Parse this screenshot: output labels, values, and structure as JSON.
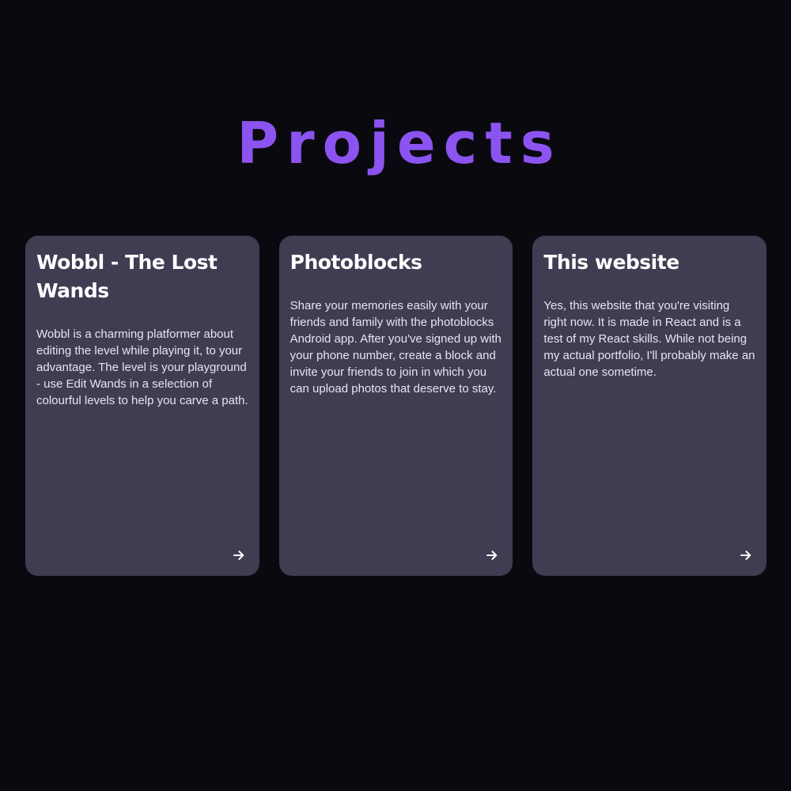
{
  "page": {
    "title": "Projects",
    "colors": {
      "background": "#0b0910",
      "accent": "#8b54f0",
      "card": "#3e3d52",
      "text": "#ffffff"
    }
  },
  "projects": [
    {
      "title": "Wobbl - The Lost Wands",
      "description": "Wobbl is a charming platformer about editing the level while playing it, to your advantage. The level is your playground - use Edit Wands in a selection of colourful levels to help you carve a path.",
      "icon": "arrow-right-icon"
    },
    {
      "title": "Photoblocks",
      "description": "Share your memories easily with your friends and family with the photoblocks Android app. After you've signed up with your phone number, create a block and invite your friends to join in which you can upload photos that deserve to stay.",
      "icon": "arrow-right-icon"
    },
    {
      "title": "This website",
      "description": "Yes, this website that you're visiting right now. It is made in React and is a test of my React skills. While not being my actual portfolio, I'll probably make an actual one sometime.",
      "icon": "arrow-right-icon"
    }
  ]
}
